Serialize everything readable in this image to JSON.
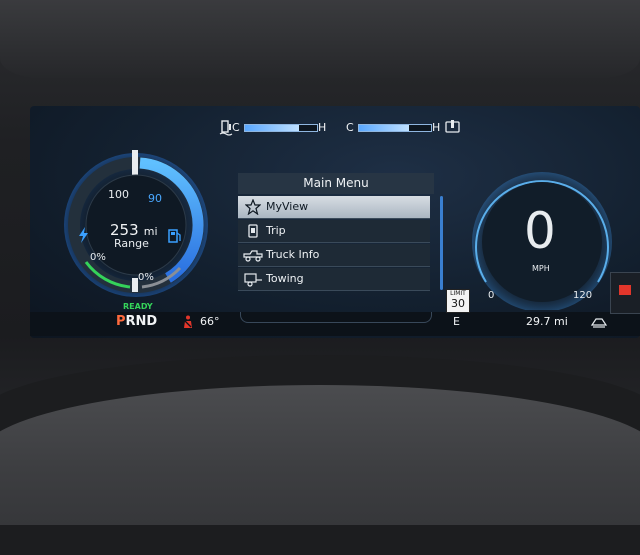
{
  "temps": {
    "left": {
      "icon": "coolant-temp-icon",
      "cold_label": "C",
      "hot_label": "H",
      "level": 0.75
    },
    "right": {
      "icon": "oil-temp-icon",
      "cold_label": "C",
      "hot_label": "H",
      "level": 0.7
    }
  },
  "range_gauge": {
    "value": "253",
    "unit": "mi",
    "label": "Range",
    "top_left_tick": "100",
    "top_right_tick": "90",
    "left_percent": "0%",
    "right_percent": "0%",
    "left_icon": "charge-bolt-icon",
    "right_icon": "fuel-pump-icon",
    "ready_label": "READY",
    "accent_color": "#3aa0ff",
    "ready_color": "#35d35a"
  },
  "menu": {
    "title": "Main Menu",
    "items": [
      {
        "label": "MyView",
        "icon": "star-icon",
        "active": true
      },
      {
        "label": "Trip",
        "icon": "trip-icon",
        "active": false
      },
      {
        "label": "Truck Info",
        "icon": "truck-icon",
        "active": false
      },
      {
        "label": "Towing",
        "icon": "trailer-icon",
        "active": false
      }
    ]
  },
  "speedometer": {
    "speed": "0",
    "unit": "MPH",
    "min_label": "0",
    "max_label": "120"
  },
  "speed_limit": {
    "title": "LIMIT",
    "value": "30"
  },
  "status_bar": {
    "gear_selected": "P",
    "gear_rest": "RND",
    "gear_selected_color": "#ff6a3d",
    "outside_temp": "66°",
    "compass": "E",
    "odometer_trip": "29.7 mi",
    "seatbelt_icon": "seatbelt-warning-icon",
    "drive_mode_icon": "drive-mode-icon"
  }
}
